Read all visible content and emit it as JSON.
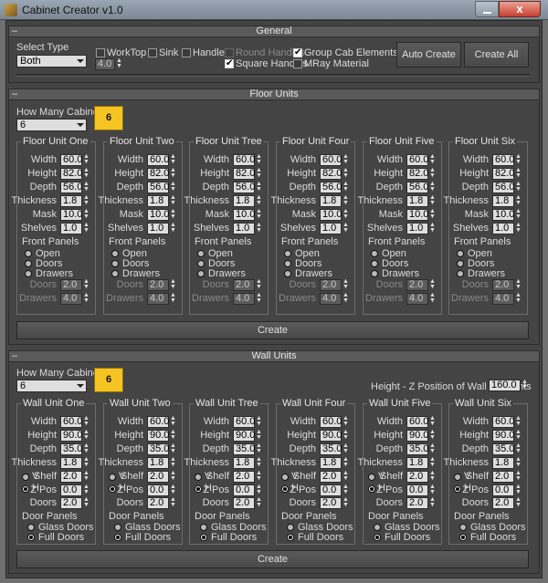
{
  "window": {
    "title": "Cabinet Creator v1.0",
    "close_glyph": "x"
  },
  "general": {
    "header": "General",
    "select_type_label": "Select Type",
    "select_type_value": "Both",
    "thickness_value": "4.0",
    "checks": [
      {
        "label": "WorkTop",
        "checked": false,
        "enabled": true
      },
      {
        "label": "Sink",
        "checked": false,
        "enabled": true
      },
      {
        "label": "Handles",
        "checked": false,
        "enabled": true
      },
      {
        "label": "Round Handles",
        "checked": false,
        "enabled": false
      },
      {
        "label": "Square Handles",
        "checked": true,
        "enabled": true
      },
      {
        "label": "Group Cab Elements",
        "checked": true,
        "enabled": true
      },
      {
        "label": "MRay Material",
        "checked": false,
        "enabled": true
      }
    ],
    "auto_create": "Auto Create",
    "create_all": "Create All"
  },
  "floor": {
    "header": "Floor Units",
    "how_many_label": "How Many Cabinets?",
    "count_value": "6",
    "count_badge": "6",
    "field_labels": [
      "Width",
      "Height",
      "Depth",
      "Thickness",
      "Mask",
      "Shelves"
    ],
    "front_panels_label": "Front Panels",
    "radio_labels": [
      "Open",
      "Doors",
      "Drawers"
    ],
    "doors_label": "Doors",
    "drawers_label": "Drawers",
    "create": "Create",
    "units": [
      {
        "title": "Floor Unit One",
        "values": [
          "60.0",
          "82.0",
          "56.0",
          "1.8",
          "10.0",
          "1.0"
        ],
        "doors": "2.0",
        "drawers": "4.0"
      },
      {
        "title": "Floor Unit Two",
        "values": [
          "60.0",
          "82.0",
          "56.0",
          "1.8",
          "10.0",
          "1.0"
        ],
        "doors": "2.0",
        "drawers": "4.0"
      },
      {
        "title": "Floor Unit Tree",
        "values": [
          "60.0",
          "82.0",
          "56.0",
          "1.8",
          "10.0",
          "1.0"
        ],
        "doors": "2.0",
        "drawers": "4.0"
      },
      {
        "title": "Floor Unit Four",
        "values": [
          "60.0",
          "82.0",
          "56.0",
          "1.8",
          "10.0",
          "1.0"
        ],
        "doors": "2.0",
        "drawers": "4.0"
      },
      {
        "title": "Floor Unit Five",
        "values": [
          "60.0",
          "82.0",
          "56.0",
          "1.8",
          "10.0",
          "1.0"
        ],
        "doors": "2.0",
        "drawers": "4.0"
      },
      {
        "title": "Floor Unit Six",
        "values": [
          "60.0",
          "82.0",
          "56.0",
          "1.8",
          "10.0",
          "1.0"
        ],
        "doors": "2.0",
        "drawers": "4.0"
      }
    ]
  },
  "wall": {
    "header": "Wall Units",
    "how_many_label": "How Many Cabinets?",
    "count_value": "6",
    "count_badge": "6",
    "height_pos_label": "Height - Z Position of Wall Elements",
    "height_pos_value": "160.0",
    "field_labels": [
      "Width",
      "Height",
      "Depth",
      "Thickness",
      "Shelf",
      "Z Pos",
      "Doors"
    ],
    "v_label": "V",
    "h_label": "H",
    "door_panels_label": "Door Panels",
    "door_radio_labels": [
      "Glass Doors",
      "Full Doors"
    ],
    "create": "Create",
    "units": [
      {
        "title": "Wall Unit One",
        "values": [
          "60.0",
          "90.0",
          "35.0",
          "1.8",
          "2.0",
          "0.0",
          "2.0"
        ]
      },
      {
        "title": "Wall Unit Two",
        "values": [
          "60.0",
          "90.0",
          "35.0",
          "1.8",
          "2.0",
          "0.0",
          "2.0"
        ]
      },
      {
        "title": "Wall Unit Tree",
        "values": [
          "60.0",
          "90.0",
          "35.0",
          "1.8",
          "2.0",
          "0.0",
          "2.0"
        ]
      },
      {
        "title": "Wall Unit Four",
        "values": [
          "60.0",
          "90.0",
          "35.0",
          "1.8",
          "2.0",
          "0.0",
          "2.0"
        ]
      },
      {
        "title": "Wall Unit Five",
        "values": [
          "60.0",
          "90.0",
          "35.0",
          "1.8",
          "2.0",
          "0.0",
          "2.0"
        ]
      },
      {
        "title": "Wall Unit Six",
        "values": [
          "60.0",
          "90.0",
          "35.0",
          "1.8",
          "2.0",
          "0.0",
          "2.0"
        ]
      }
    ]
  }
}
